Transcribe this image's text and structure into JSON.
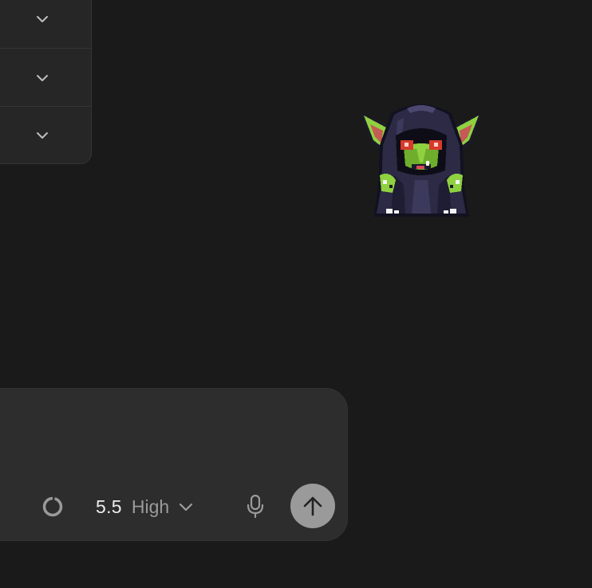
{
  "panel": {
    "rows": [
      {
        "icon": "chevron-down-icon"
      },
      {
        "icon": "chevron-down-icon"
      },
      {
        "icon": "chevron-down-icon"
      }
    ]
  },
  "mascot": {
    "icon": "goblin-sprite"
  },
  "composer": {
    "context_icon": "context-ring-icon",
    "model": {
      "version": "5.5",
      "effort": "High",
      "icon": "chevron-down-icon"
    },
    "mic_icon": "microphone-icon",
    "send_icon": "arrow-up-icon"
  },
  "colors": {
    "background": "#1a1a1b",
    "panel": "#262627",
    "composer": "#2d2d2e",
    "send_button": "#9a9a9b",
    "goblin_skin": "#8fd13f",
    "goblin_cloak": "#2c2a45"
  }
}
